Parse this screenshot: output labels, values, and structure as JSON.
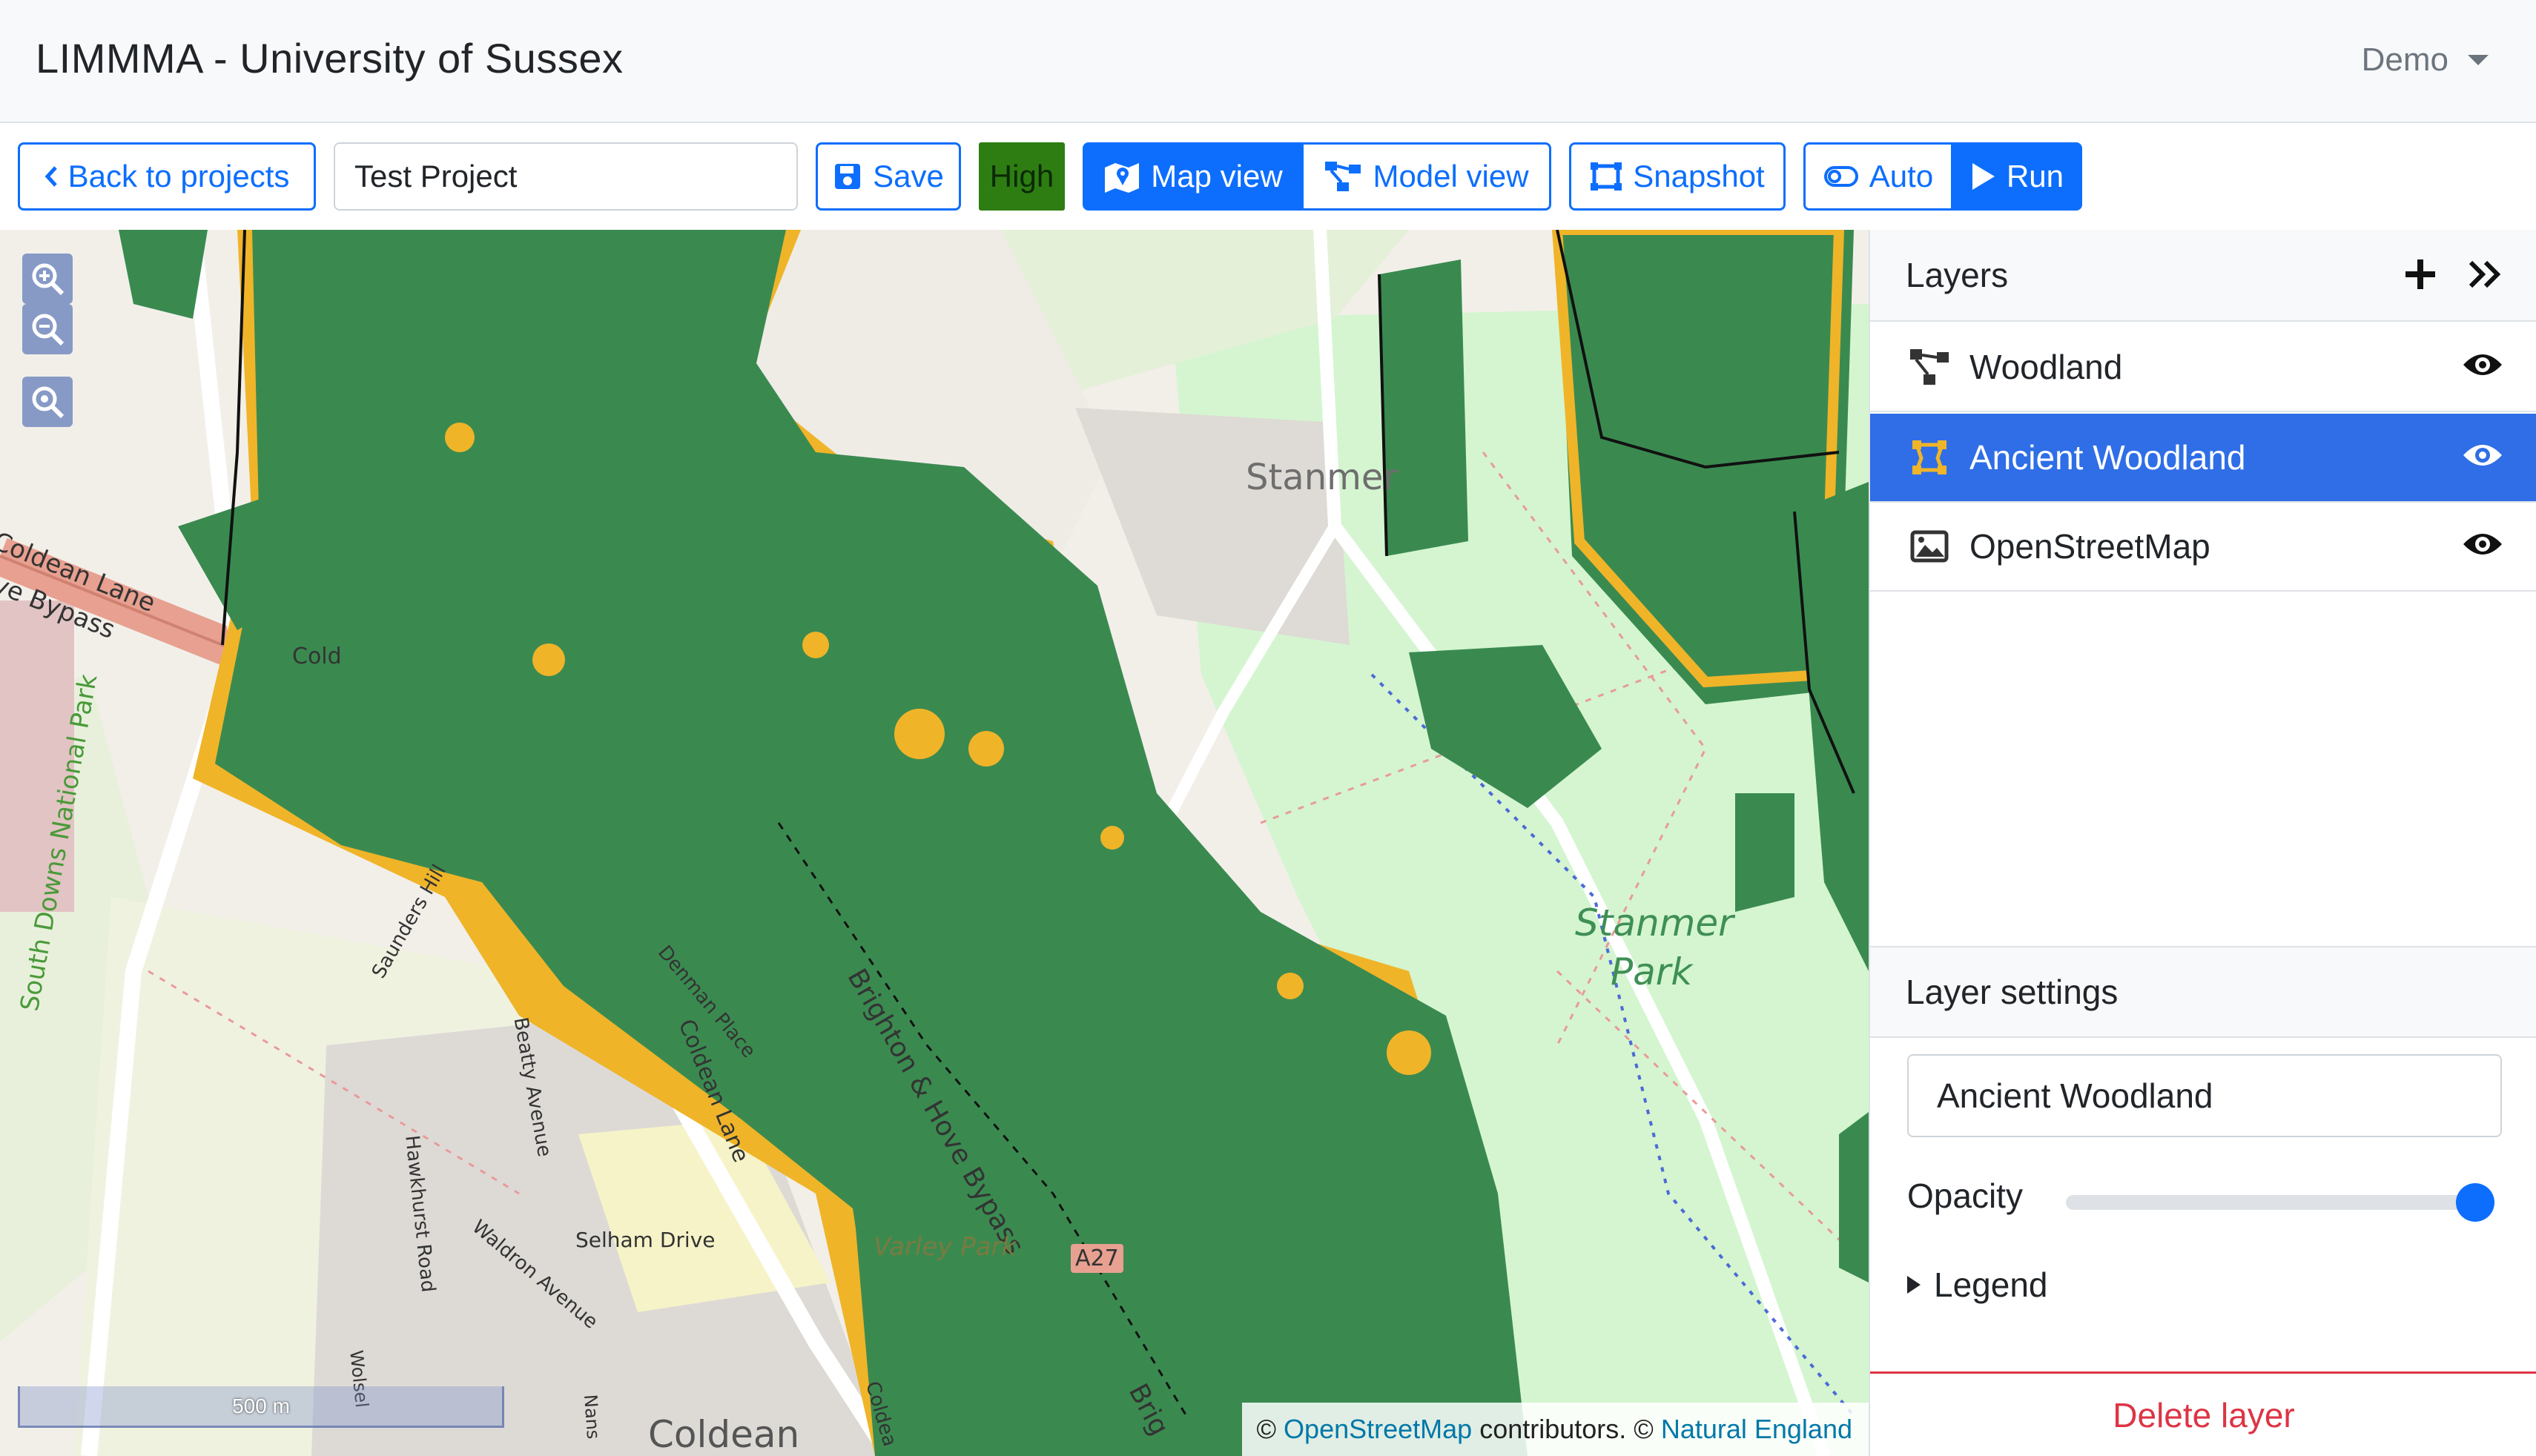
{
  "app": {
    "title": "LIMMMA - University of Sussex",
    "user": "Demo"
  },
  "toolbar": {
    "back_label": "Back to projects",
    "project_name": "Test Project",
    "save_label": "Save",
    "quality_label": "High",
    "map_view_label": "Map view",
    "model_view_label": "Model view",
    "snapshot_label": "Snapshot",
    "auto_label": "Auto",
    "run_label": "Run"
  },
  "map": {
    "labels": {
      "coldean_lane_1": "Coldean Lane",
      "bypass_1": "ve Bypass",
      "cold": "Cold",
      "south_downs": "South Downs National Park",
      "stanmer": "Stanmer",
      "stanmer_park_1": "Stanmer",
      "stanmer_park_2": "Park",
      "saunders_hill": "Saunders Hill",
      "denman_place": "Denman Place",
      "coldean_lane_2": "Coldean Lane",
      "brighton_bypass": "Brighton & Hove Bypass",
      "beatty_avenue": "Beatty Avenue",
      "hawkhurst_road": "Hawkhurst Road",
      "waldron_avenue": "Waldron Avenue",
      "selham_drive": "Selham Drive",
      "varley_park": "Varley Park",
      "a27": "A27",
      "coldean": "Coldean",
      "brig": "Brig",
      "wolseley": "Wolsel",
      "nans": "Nans",
      "coldea": "Coldea"
    },
    "scale_label": "500 m",
    "attribution": {
      "prefix": "©",
      "osm_link": "OpenStreetMap",
      "mid": "contributors. ©",
      "ne_link": "Natural England"
    }
  },
  "layers_panel": {
    "title": "Layers",
    "layers": [
      {
        "name": "Woodland",
        "icon": "graph-icon",
        "visible": true,
        "selected": false
      },
      {
        "name": "Ancient Woodland",
        "icon": "polygon-icon",
        "visible": true,
        "selected": true
      },
      {
        "name": "OpenStreetMap",
        "icon": "image-icon",
        "visible": true,
        "selected": false
      }
    ]
  },
  "layer_settings": {
    "title": "Layer settings",
    "name_value": "Ancient Woodland",
    "opacity_label": "Opacity",
    "opacity_value": 1.0,
    "legend_label": "Legend",
    "delete_label": "Delete layer"
  },
  "colors": {
    "accent": "#0d6efd",
    "woodland": "#3a8a50",
    "ancient_woodland": "#f0b429",
    "park": "#d4f5d0",
    "bypass": "#e8a090",
    "danger": "#dc3545"
  }
}
